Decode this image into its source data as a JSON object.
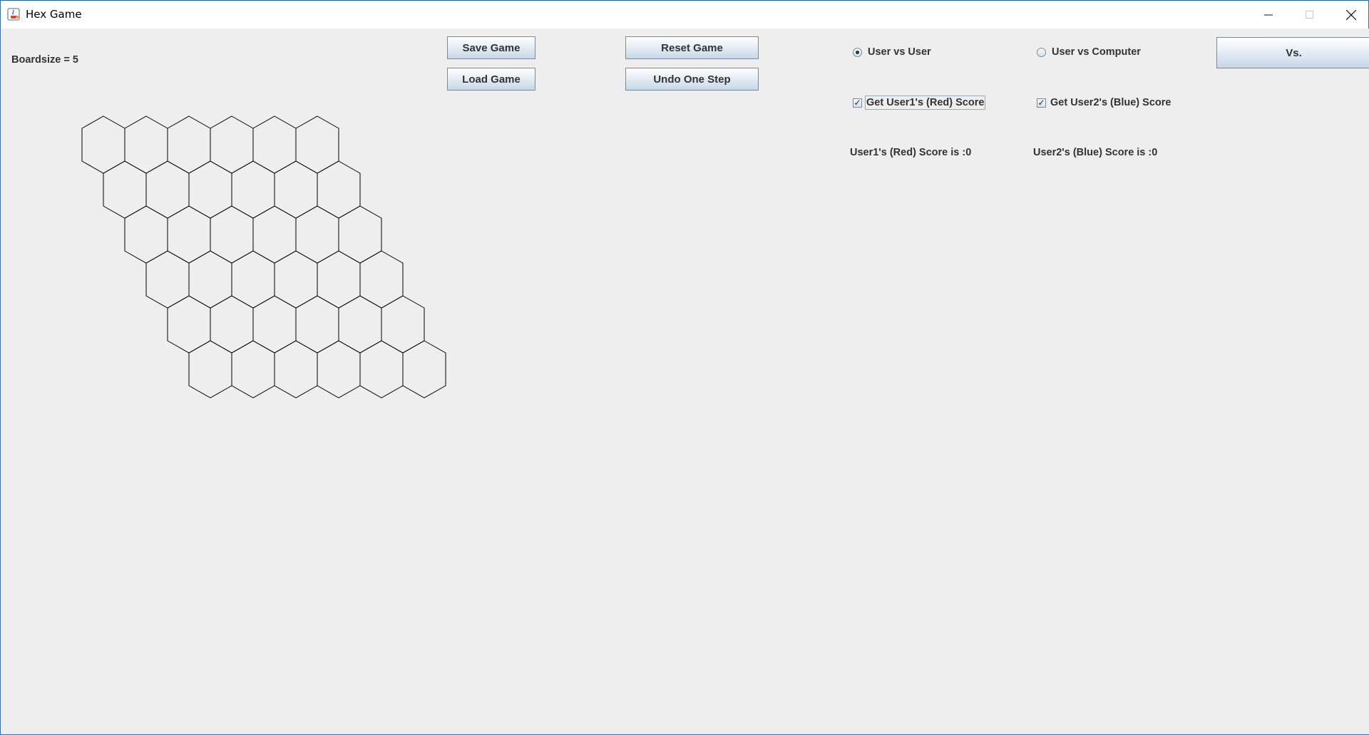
{
  "window": {
    "title": "Hex Game",
    "minimize_icon": "minimize-icon",
    "maximize_icon": "maximize-icon",
    "close_icon": "close-icon"
  },
  "info": {
    "boardsize_label": "Boardsize = 5"
  },
  "buttons": {
    "save": "Save Game",
    "load": "Load Game",
    "reset": "Reset Game",
    "undo": "Undo One Step",
    "vs": "Vs."
  },
  "mode": {
    "user_vs_user": "User vs User",
    "user_vs_computer": "User vs Computer",
    "selected": "User vs User"
  },
  "score_options": {
    "red": "Get User1's (Red) Score",
    "red_checked": true,
    "blue": "Get User2's (Blue) Score",
    "blue_checked": true
  },
  "scores": {
    "red_text": "User1's (Red) Score is :0",
    "blue_text": "User2's (Blue) Score is :0"
  },
  "board": {
    "rows": 6,
    "cols": 6,
    "line_color": "#000000",
    "cells": []
  }
}
